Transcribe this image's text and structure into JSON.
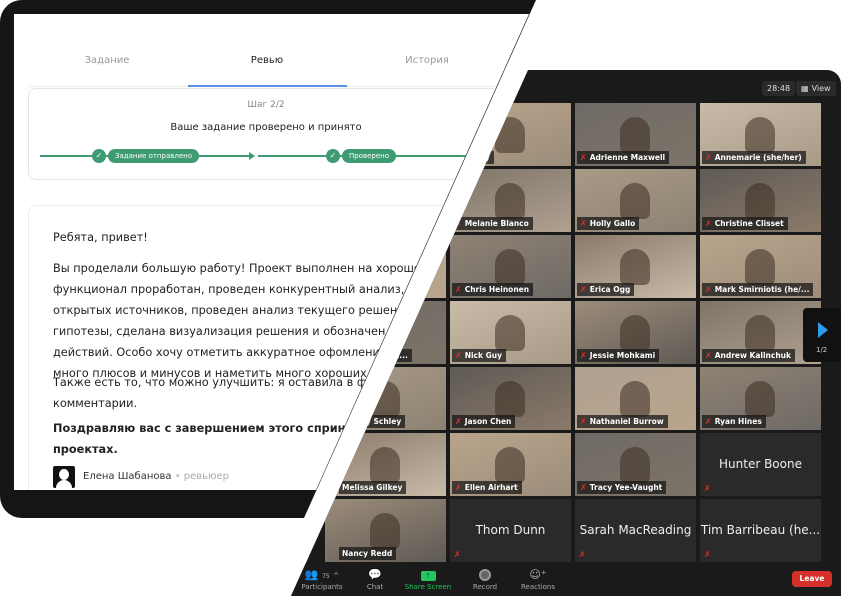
{
  "review_card": {
    "tabs": [
      {
        "label": "Задание",
        "active": false
      },
      {
        "label": "Ревью",
        "active": true
      },
      {
        "label": "История",
        "active": false
      }
    ],
    "step": "Шаг 2/2",
    "status": "Ваше задание проверено и принято",
    "progress": [
      "Задание отправлено",
      "Проверено"
    ],
    "accent_color": "#3e9b72",
    "greeting": "Ребята, привет!",
    "paragraph1_lines": [
      "Вы проделали большую работу! Проект выполнен на хорошем уров",
      "функционал проработан, проведен конкурентный анализ, подобра",
      "открытых источников, проведен анализ текущего решения и каст",
      "гипотезы, сделана визуализация решения и обозначен план дал",
      "действий. Особо хочу отметить аккуратное офомление. Вам у",
      "много плюсов и минусов и наметить много хороших решени"
    ],
    "paragraph2_lines": [
      "Также есть то, что можно улучшить: я оставила в фигме со",
      "комментарии."
    ],
    "closing_lines": [
      "Поздравляю вас с завершением этого спринта! Жела",
      "проектах."
    ],
    "author": "Елена Шабанова",
    "author_role": "ревьюер"
  },
  "zoom": {
    "timer": "28:48",
    "view_label": "View",
    "page_indicator": "1/2",
    "tiles": [
      [
        {
          "name": "",
          "video": true
        },
        {
          "name": "Gorny",
          "video": true
        },
        {
          "name": "Adrienne Maxwell",
          "video": true
        },
        {
          "name": "Annemarie (she/her)",
          "video": true
        }
      ],
      [
        {
          "name": "",
          "video": true
        },
        {
          "name": "Melanie Blanco",
          "video": true
        },
        {
          "name": "Holly Gallo",
          "video": true
        },
        {
          "name": "Christine Clisset",
          "video": true
        }
      ],
      [
        {
          "name": "",
          "video": true
        },
        {
          "name": "Chris Heinonen",
          "video": true
        },
        {
          "name": "Erica Ogg",
          "video": true
        },
        {
          "name": "Mark Smirniotis (he/...",
          "video": true
        }
      ],
      [
        {
          "name": "ey/t...",
          "video": true
        },
        {
          "name": "Nick Guy",
          "video": true
        },
        {
          "name": "Jessie Mohkami",
          "video": true
        },
        {
          "name": "Andrew Kalinchuk",
          "video": true
        }
      ],
      [
        {
          "name": "y Schley",
          "video": true
        },
        {
          "name": "Jason Chen",
          "video": true
        },
        {
          "name": "Nathaniel Burrow",
          "video": true
        },
        {
          "name": "Ryan Hines",
          "video": true
        }
      ],
      [
        {
          "name": "Melissa Gilkey",
          "video": true
        },
        {
          "name": "Ellen Airhart",
          "video": true
        },
        {
          "name": "Tracy Yee-Vaught",
          "video": true
        },
        {
          "name": "Hunter Boone",
          "video": false
        }
      ],
      [
        {
          "name": "Nancy Redd",
          "video": true
        },
        {
          "name": "Thom Dunn",
          "video": false
        },
        {
          "name": "Sarah MacReading",
          "video": false
        },
        {
          "name": "Tim Barribeau (he...",
          "video": false
        }
      ]
    ],
    "toolbar": {
      "participants_label": "Participants",
      "participants_count": "75",
      "chat_label": "Chat",
      "share_label": "Share Screen",
      "record_label": "Record",
      "reactions_label": "Reactions",
      "leave_label": "Leave"
    },
    "colors": {
      "share": "#22c55e",
      "leave": "#d6302b",
      "muted": "#e0312b"
    }
  }
}
